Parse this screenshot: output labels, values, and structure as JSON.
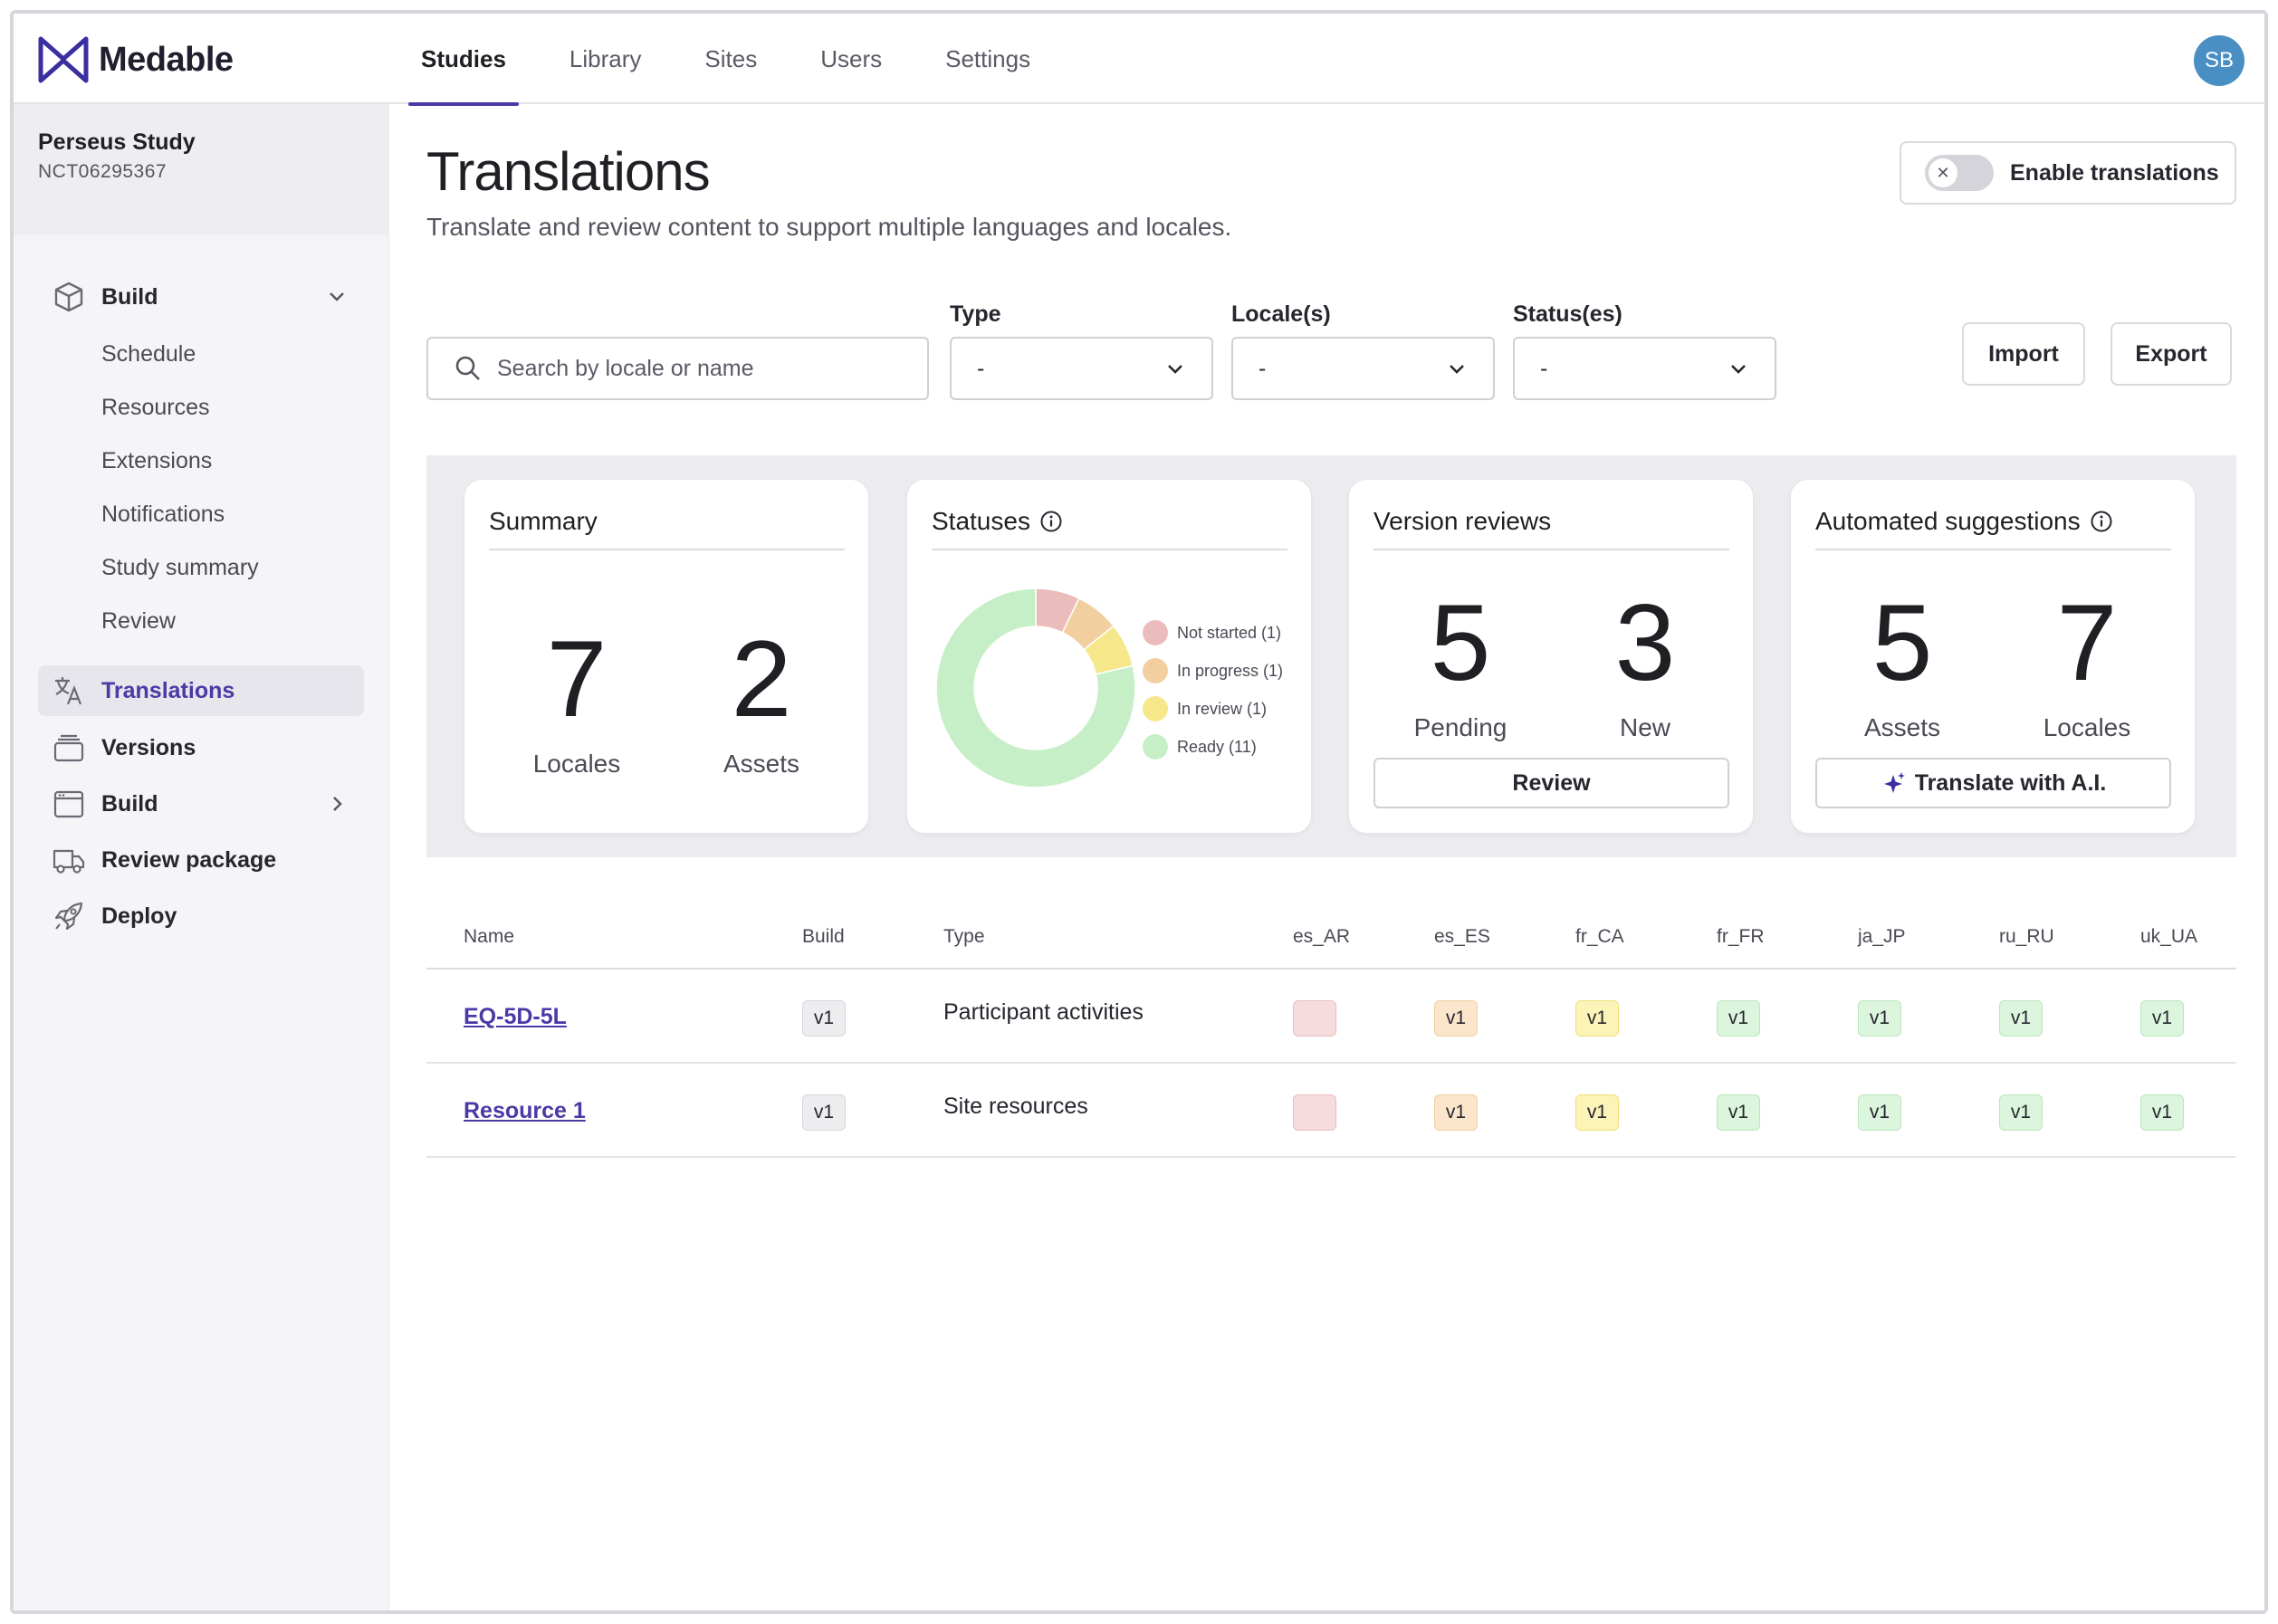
{
  "app": {
    "brand": "Medable"
  },
  "nav": {
    "tabs": [
      {
        "label": "Studies",
        "active": true
      },
      {
        "label": "Library"
      },
      {
        "label": "Sites"
      },
      {
        "label": "Users"
      },
      {
        "label": "Settings"
      }
    ],
    "avatar": "SB"
  },
  "study": {
    "name": "Perseus Study",
    "id": "NCT06295367"
  },
  "sidebar": {
    "build_group": {
      "label": "Build",
      "children": [
        "Schedule",
        "Resources",
        "Extensions",
        "Notifications",
        "Study summary",
        "Review"
      ]
    },
    "items": [
      {
        "label": "Translations",
        "icon": "translate-icon",
        "active": true
      },
      {
        "label": "Versions",
        "icon": "versions-icon"
      },
      {
        "label": "Build",
        "icon": "browser-window-icon"
      },
      {
        "label": "Review package",
        "icon": "truck-icon"
      },
      {
        "label": "Deploy",
        "icon": "rocket-icon"
      }
    ]
  },
  "page": {
    "title": "Translations",
    "subtitle": "Translate and review content to support multiple languages and locales.",
    "enable_translations": {
      "label": "Enable translations",
      "enabled": false
    }
  },
  "filters": {
    "search_placeholder": "Search by locale or name",
    "type": {
      "label": "Type",
      "value": "-"
    },
    "locales": {
      "label": "Locale(s)",
      "value": "-"
    },
    "statuses": {
      "label": "Status(es)",
      "value": "-"
    },
    "import_label": "Import",
    "export_label": "Export"
  },
  "summary": {
    "title": "Summary",
    "locales": {
      "value": "7",
      "label": "Locales"
    },
    "assets": {
      "value": "2",
      "label": "Assets"
    }
  },
  "statuses": {
    "title": "Statuses",
    "legend": [
      {
        "label": "Not started (1)",
        "color": "#ebbcbc"
      },
      {
        "label": "In progress (1)",
        "color": "#f1cf9f"
      },
      {
        "label": "In review (1)",
        "color": "#f6e88a"
      },
      {
        "label": "Ready (11)",
        "color": "#c6efc8"
      }
    ]
  },
  "chart_data": {
    "type": "pie",
    "categories": [
      "Not started",
      "In progress",
      "In review",
      "Ready"
    ],
    "values": [
      1,
      1,
      1,
      11
    ],
    "colors": [
      "#ebbcbc",
      "#f1cf9f",
      "#f6e88a",
      "#c6efc8"
    ],
    "title": "Statuses"
  },
  "version_reviews": {
    "title": "Version reviews",
    "pending": {
      "value": "5",
      "label": "Pending"
    },
    "new": {
      "value": "3",
      "label": "New"
    },
    "button": "Review"
  },
  "automated": {
    "title": "Automated suggestions",
    "assets": {
      "value": "5",
      "label": "Assets"
    },
    "locales": {
      "value": "7",
      "label": "Locales"
    },
    "button": "Translate with A.I."
  },
  "table": {
    "headers": [
      "Name",
      "Build",
      "Type",
      "es_AR",
      "es_ES",
      "fr_CA",
      "fr_FR",
      "ja_JP",
      "ru_RU",
      "uk_UA"
    ],
    "rows": [
      {
        "name": "EQ-5D-5L",
        "build": "v1",
        "type": "Participant activities",
        "locales": [
          {
            "label": "",
            "status": "not-started"
          },
          {
            "label": "v1",
            "status": "in-progress"
          },
          {
            "label": "v1",
            "status": "in-review"
          },
          {
            "label": "v1",
            "status": "ready"
          },
          {
            "label": "v1",
            "status": "ready"
          },
          {
            "label": "v1",
            "status": "ready"
          },
          {
            "label": "v1",
            "status": "ready"
          }
        ]
      },
      {
        "name": "Resource 1",
        "build": "v1",
        "type": "Site resources",
        "locales": [
          {
            "label": "",
            "status": "not-started"
          },
          {
            "label": "v1",
            "status": "in-progress"
          },
          {
            "label": "v1",
            "status": "in-review"
          },
          {
            "label": "v1",
            "status": "ready"
          },
          {
            "label": "v1",
            "status": "ready"
          },
          {
            "label": "v1",
            "status": "ready"
          },
          {
            "label": "v1",
            "status": "ready"
          }
        ]
      }
    ]
  }
}
